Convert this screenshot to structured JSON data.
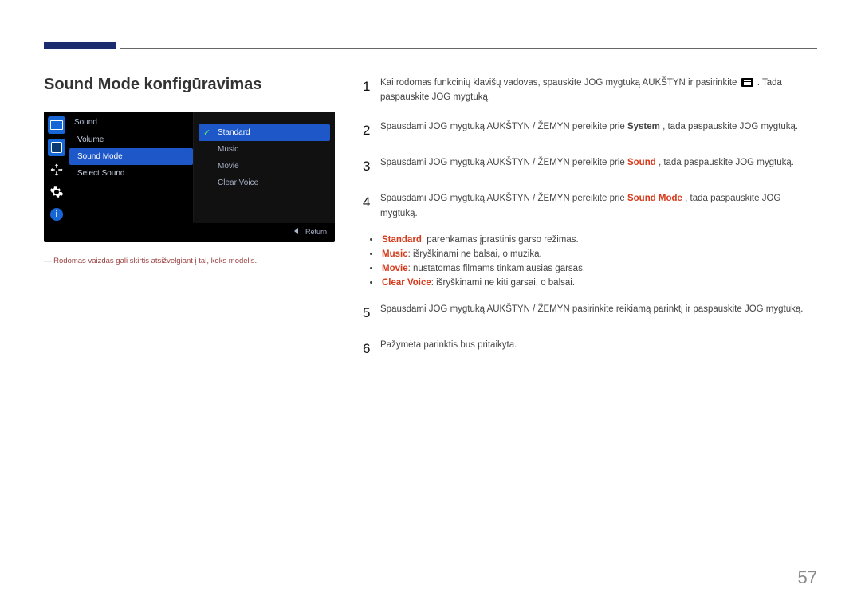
{
  "title": "Sound Mode konfigūravimas",
  "osd": {
    "header": "Sound",
    "items": [
      "Volume",
      "Sound Mode",
      "Select Sound"
    ],
    "selected_index": 1,
    "submenu": {
      "items": [
        "Standard",
        "Music",
        "Movie",
        "Clear Voice"
      ],
      "selected_index": 0
    },
    "return": "Return"
  },
  "footnote_dash": "―",
  "footnote": "Rodomas vaizdas gali skirtis atsižvelgiant į tai, koks modelis.",
  "steps": {
    "s1a": "Kai rodomas funkcinių klavišų vadovas, spauskite JOG mygtuką AUKŠTYN ir pasirinkite ",
    "s1b": ". Tada paspauskite JOG mygtuką.",
    "s2a": "Spausdami JOG mygtuką AUKŠTYN / ŽEMYN pereikite prie ",
    "s2system": "System",
    "s2b": ", tada paspauskite JOG mygtuką.",
    "s3a": "Spausdami JOG mygtuką AUKŠTYN / ŽEMYN pereikite prie ",
    "s3sound": "Sound",
    "s3b": ", tada paspauskite JOG mygtuką.",
    "s4a": "Spausdami JOG mygtuką AUKŠTYN / ŽEMYN pereikite prie ",
    "s4sm": "Sound Mode",
    "s4b": ", tada paspauskite JOG mygtuką.",
    "s5": "Spausdami JOG mygtuką AUKŠTYN / ŽEMYN pasirinkite reikiamą parinktį ir paspauskite JOG mygtuką.",
    "s6": "Pažymėta parinktis bus pritaikyta."
  },
  "bullets": {
    "b1k": "Standard",
    "b1v": ": parenkamas įprastinis garso režimas.",
    "b2k": "Music",
    "b2v": ": išryškinami ne balsai, o muzika.",
    "b3k": "Movie",
    "b3v": ": nustatomas filmams tinkamiausias garsas.",
    "b4k": "Clear Voice",
    "b4v": ": išryškinami ne kiti garsai, o balsai."
  },
  "page_number": "57"
}
